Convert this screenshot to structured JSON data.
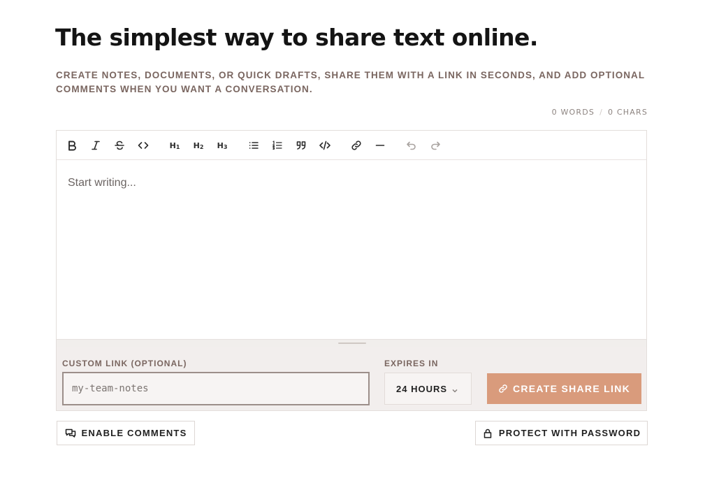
{
  "hero": {
    "title": "The simplest way to share text online.",
    "subtitle": "Create notes, documents, or quick drafts, share them with a link in seconds, and add optional comments when you want a conversation."
  },
  "stats": {
    "words": "0 WORDS",
    "separator": "/",
    "chars": "0 CHARS"
  },
  "toolbar": {
    "h1": "H",
    "h1_sub": "1",
    "h2": "H",
    "h2_sub": "2",
    "h3": "H",
    "h3_sub": "3",
    "icons": [
      "bold-icon",
      "italic-icon",
      "strikethrough-icon",
      "inline-code-icon",
      "heading-1-icon",
      "heading-2-icon",
      "heading-3-icon",
      "bullet-list-icon",
      "ordered-list-icon",
      "blockquote-icon",
      "code-block-icon",
      "link-icon",
      "horizontal-rule-icon",
      "undo-icon",
      "redo-icon"
    ]
  },
  "editor": {
    "placeholder": "Start writing..."
  },
  "share": {
    "custom_link_label": "CUSTOM LINK (OPTIONAL)",
    "custom_link_placeholder": "my-team-notes",
    "custom_link_value": "",
    "expires_label": "EXPIRES IN",
    "expires_value": "24 HOURS",
    "create_label": "CREATE SHARE LINK"
  },
  "options": {
    "comments_label": "ENABLE COMMENTS",
    "password_label": "PROTECT WITH PASSWORD"
  },
  "colors": {
    "accent": "#d99b7c",
    "muted_text": "#7a6660",
    "panel_bg": "#f2eeed"
  }
}
